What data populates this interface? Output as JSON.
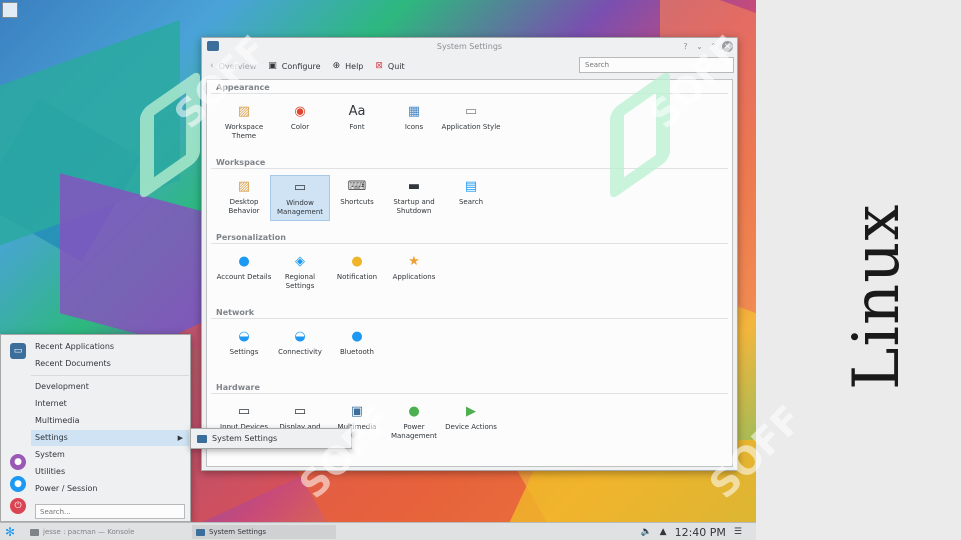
{
  "window": {
    "title": "System Settings",
    "controls": [
      "?",
      "⌄",
      "⌃",
      "✕"
    ]
  },
  "toolbar": {
    "overview_label": "Overview",
    "configure_label": "Configure",
    "help_label": "Help",
    "quit_label": "Quit",
    "search_placeholder": "Search"
  },
  "sections": [
    {
      "title": "Appearance",
      "items": [
        {
          "label": "Workspace Theme",
          "icon": "workspace-theme-icon",
          "color": "#d9a04c"
        },
        {
          "label": "Color",
          "icon": "color-wheel-icon",
          "color": "#e0462f"
        },
        {
          "label": "Font",
          "icon": "font-icon",
          "color": "#31363b"
        },
        {
          "label": "Icons",
          "icon": "icons-icon",
          "color": "#4a89c8"
        },
        {
          "label": "Application Style",
          "icon": "application-style-icon",
          "color": "#7f8489"
        }
      ]
    },
    {
      "title": "Workspace",
      "items": [
        {
          "label": "Desktop Behavior",
          "icon": "desktop-behavior-icon",
          "color": "#d9a04c"
        },
        {
          "label": "Window Management",
          "icon": "window-management-icon",
          "color": "#31363b",
          "selected": true
        },
        {
          "label": "Shortcuts",
          "icon": "keyboard-icon",
          "color": "#4d4d4d"
        },
        {
          "label": "Startup and Shutdown",
          "icon": "startup-icon",
          "color": "#31363b"
        },
        {
          "label": "Search",
          "icon": "search-doc-icon",
          "color": "#1d99f3"
        }
      ]
    },
    {
      "title": "Personalization",
      "items": [
        {
          "label": "Account Details",
          "icon": "account-icon",
          "color": "#1d99f3"
        },
        {
          "label": "Regional Settings",
          "icon": "regional-icon",
          "color": "#1d99f3"
        },
        {
          "label": "Notification",
          "icon": "notification-icon",
          "color": "#f0b429"
        },
        {
          "label": "Applications",
          "icon": "applications-star-icon",
          "color": "#f0a030"
        }
      ]
    },
    {
      "title": "Network",
      "items": [
        {
          "label": "Settings",
          "icon": "network-settings-icon",
          "color": "#1d99f3"
        },
        {
          "label": "Connectivity",
          "icon": "connectivity-icon",
          "color": "#1d99f3"
        },
        {
          "label": "Bluetooth",
          "icon": "bluetooth-icon",
          "color": "#1d99f3"
        }
      ]
    },
    {
      "title": "Hardware",
      "items": [
        {
          "label": "Input Devices",
          "icon": "input-devices-icon",
          "color": "#31363b"
        },
        {
          "label": "Display and",
          "icon": "display-icon",
          "color": "#31363b"
        },
        {
          "label": "Multimedia",
          "icon": "multimedia-icon",
          "color": "#3c6e9c"
        },
        {
          "label": "Power Management",
          "icon": "power-management-icon",
          "color": "#4caf50"
        },
        {
          "label": "Device Actions",
          "icon": "device-actions-icon",
          "color": "#4caf50"
        }
      ]
    }
  ],
  "menu": {
    "items": [
      {
        "label": "Recent Applications"
      },
      {
        "label": "Recent Documents"
      },
      {
        "label": "Development"
      },
      {
        "label": "Internet"
      },
      {
        "label": "Multimedia"
      },
      {
        "label": "Settings",
        "active": true
      },
      {
        "label": "System"
      },
      {
        "label": "Utilities"
      },
      {
        "label": "Power / Session"
      }
    ],
    "search_placeholder": "Search...",
    "submenu_label": "System Settings"
  },
  "taskbar": {
    "task1_label": "jesse : pacman — Konsole",
    "task2_label": "System Settings",
    "clock": "12:40 PM"
  },
  "brand": {
    "text": "Linux"
  },
  "watermark": "SOFF"
}
